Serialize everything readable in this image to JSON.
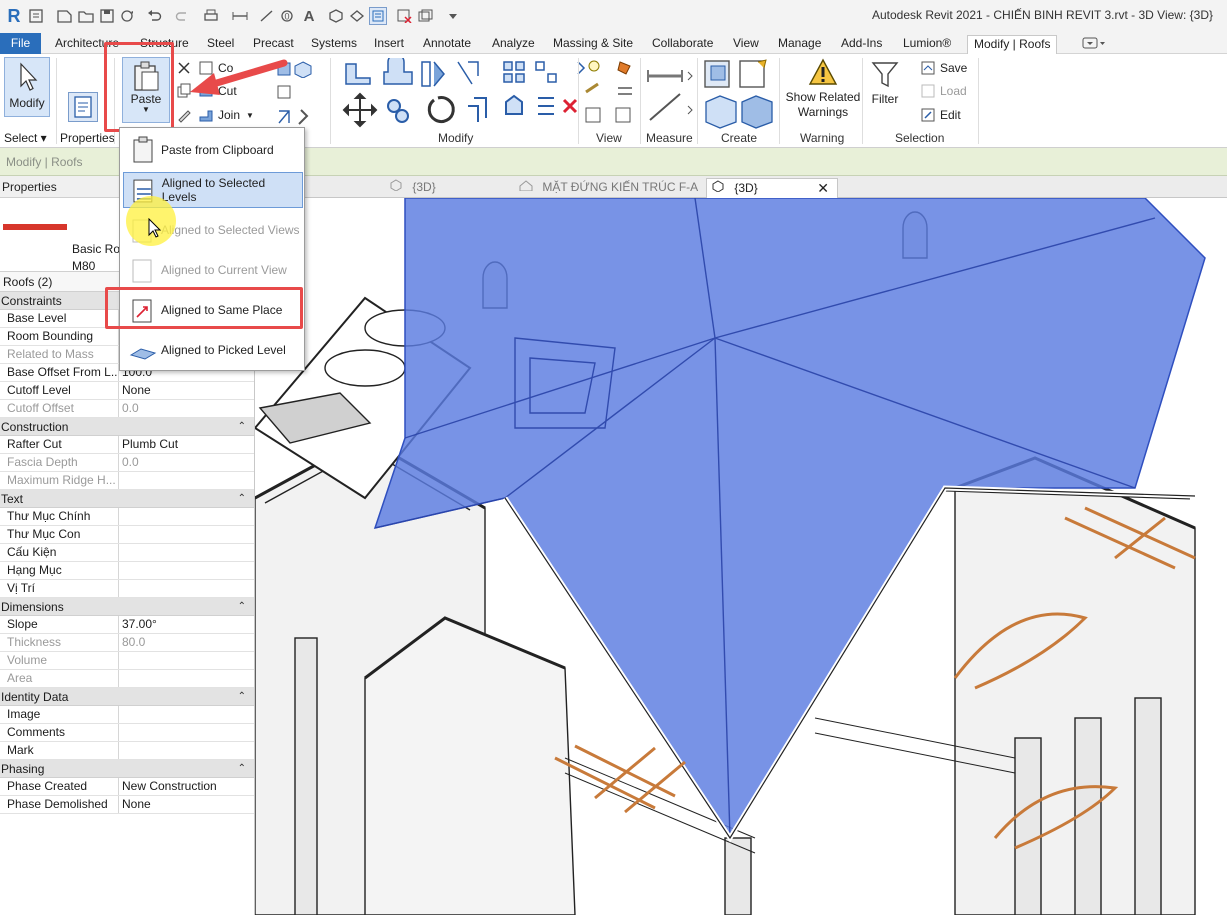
{
  "window": {
    "title": "Autodesk Revit 2021 - CHIẾN BINH REVIT 3.rvt - 3D View: {3D}",
    "app_logo": "R"
  },
  "tabs": [
    {
      "label": "File"
    },
    {
      "label": "Architecture"
    },
    {
      "label": "Structure"
    },
    {
      "label": "Steel"
    },
    {
      "label": "Precast"
    },
    {
      "label": "Systems"
    },
    {
      "label": "Insert"
    },
    {
      "label": "Annotate"
    },
    {
      "label": "Analyze"
    },
    {
      "label": "Massing & Site"
    },
    {
      "label": "Collaborate"
    },
    {
      "label": "View"
    },
    {
      "label": "Manage"
    },
    {
      "label": "Add-Ins"
    },
    {
      "label": "Lumion®"
    },
    {
      "label": "Modify | Roofs"
    }
  ],
  "ribbon": {
    "modify": "Modify",
    "select": "Select ▾",
    "properties": "Properties",
    "paste": "Paste",
    "cut": "Cut",
    "join": "Join",
    "cope": "Co",
    "panels": {
      "modify": "Modify",
      "view": "View",
      "measure": "Measure",
      "create": "Create",
      "warning": "Warning",
      "selection": "Selection"
    },
    "show_related_warnings": [
      "Show Related",
      "Warnings"
    ],
    "filter": "Filter",
    "save": "Save",
    "load": "Load",
    "edit": "Edit"
  },
  "context_bar": "Modify | Roofs",
  "paste_menu": [
    {
      "label": "Paste from Clipboard",
      "state": "normal"
    },
    {
      "label": "Aligned to Selected Levels",
      "state": "highlighted"
    },
    {
      "label": "Aligned to Selected Views",
      "state": "disabled"
    },
    {
      "label": "Aligned to Current View",
      "state": "disabled"
    },
    {
      "label": "Aligned to Same Place",
      "state": "normal"
    },
    {
      "label": "Aligned to Picked Level",
      "state": "normal"
    }
  ],
  "properties": {
    "title": "Properties",
    "type_name": [
      "Basic Roo",
      "M80"
    ],
    "filter": "Roofs (2)",
    "groups": [
      {
        "name": "Constraints",
        "rows": [
          {
            "k": "Base Level",
            "v": ""
          },
          {
            "k": "Room Bounding",
            "v": ""
          },
          {
            "k": "Related to Mass",
            "v": "",
            "dim": true
          },
          {
            "k": "Base Offset From L...",
            "v": "100.0"
          },
          {
            "k": "Cutoff Level",
            "v": "None"
          },
          {
            "k": "Cutoff Offset",
            "v": "0.0",
            "dim": true
          }
        ]
      },
      {
        "name": "Construction",
        "rows": [
          {
            "k": "Rafter Cut",
            "v": "Plumb Cut"
          },
          {
            "k": "Fascia Depth",
            "v": "0.0",
            "dim": true
          },
          {
            "k": "Maximum Ridge H...",
            "v": "",
            "dim": true
          }
        ]
      },
      {
        "name": "Text",
        "rows": [
          {
            "k": "Thư Mục Chính",
            "v": ""
          },
          {
            "k": "Thư Mục Con",
            "v": ""
          },
          {
            "k": "Cấu Kiện",
            "v": ""
          },
          {
            "k": "Hạng Mục",
            "v": ""
          },
          {
            "k": "Vị Trí",
            "v": ""
          }
        ]
      },
      {
        "name": "Dimensions",
        "rows": [
          {
            "k": "Slope",
            "v": "37.00°"
          },
          {
            "k": "Thickness",
            "v": "80.0",
            "dim": true
          },
          {
            "k": "Volume",
            "v": "",
            "dim": true
          },
          {
            "k": "Area",
            "v": "",
            "dim": true
          }
        ]
      },
      {
        "name": "Identity Data",
        "rows": [
          {
            "k": "Image",
            "v": ""
          },
          {
            "k": "Comments",
            "v": ""
          },
          {
            "k": "Mark",
            "v": ""
          }
        ]
      },
      {
        "name": "Phasing",
        "rows": [
          {
            "k": "Phase Created",
            "v": "New Construction"
          },
          {
            "k": "Phase Demolished",
            "v": "None"
          }
        ]
      }
    ]
  },
  "view_tabs": [
    {
      "label": "{3D}",
      "state": "inactive"
    },
    {
      "label": "MẶT ĐỨNG KIẾN TRÚC F-A",
      "state": "inactive"
    },
    {
      "label": "{3D}",
      "state": "active"
    }
  ],
  "colors": {
    "accent": "#2a6ebb",
    "roof_selection": "#5a7be0",
    "annotation_red": "#e84a4a",
    "context_bar": "#e8f0d8"
  }
}
